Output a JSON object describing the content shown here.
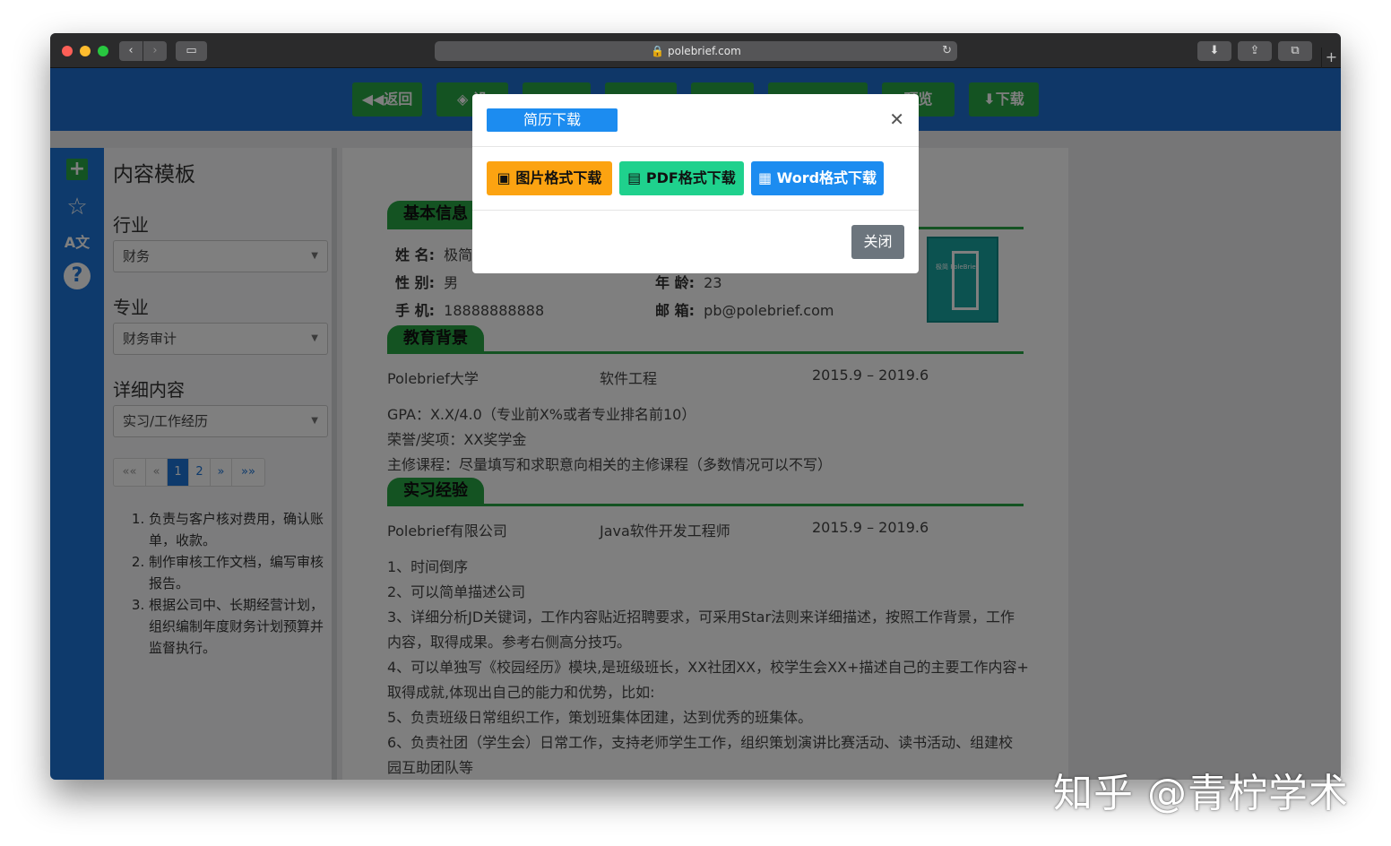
{
  "browser": {
    "url": "polebrief.com",
    "lock_icon": "lock-icon",
    "back_icon": "chevron-left-icon",
    "forward_icon": "chevron-right-icon"
  },
  "toolbar": {
    "back_label": "返回",
    "btn2_label": "设",
    "preview_label": "预览",
    "download_label": "下载"
  },
  "sidebar": {
    "title": "内容模板",
    "industry_label": "行业",
    "industry_value": "财务",
    "major_label": "专业",
    "major_value": "财务审计",
    "detail_label": "详细内容",
    "detail_value": "实习/工作经历",
    "pager": {
      "first": "««",
      "prev": "«",
      "p1": "1",
      "p2": "2",
      "next": "»",
      "last": "»»"
    },
    "items": [
      "负责与客户核对费用，确认账单，收款。",
      "制作审核工作文档，编写审核报告。",
      "根据公司中、长期经营计划，组织编制年度财务计划预算并监督执行。"
    ]
  },
  "resume": {
    "basic_title": "基本信息",
    "name_label": "姓 名:",
    "name_value": "极简",
    "gender_label": "性 别:",
    "gender_value": "男",
    "age_label": "年 龄:",
    "age_value": "23",
    "phone_label": "手 机:",
    "phone_value": "18888888888",
    "email_label": "邮 箱:",
    "email_value": "pb@polebrief.com",
    "photo_text": "极简\nPoleBrief",
    "edu_title": "教育背景",
    "edu_school": "Polebrief大学",
    "edu_major": "软件工程",
    "edu_period": "2015.9 – 2019.6",
    "edu_gpa": "GPA：X.X/4.0（专业前X%或者专业排名前10）",
    "edu_honor": "荣誉/奖项：XX奖学金",
    "edu_course": "主修课程：尽量填写和求职意向相关的主修课程（多数情况可以不写）",
    "intern_title": "实习经验",
    "intern_company": "Polebrief有限公司",
    "intern_role": "Java软件开发工程师",
    "intern_period": "2015.9 – 2019.6",
    "intern_lines": [
      "1、时间倒序",
      "2、可以简单描述公司",
      "3、详细分析JD关键词，工作内容贴近招聘要求，可采用Star法则来详细描述，按照工作背景，工作",
      "内容，取得成果。参考右侧高分技巧。",
      "4、可以单独写《校园经历》模块,是班级班长，XX社团XX，校学生会XX+描述自己的主要工作内容+",
      "取得成就,体现出自己的能力和优势，比如:",
      "5、负责班级日常组织工作，策划班集体团建，达到优秀的班集体。",
      "6、负责社团（学生会）日常工作，支持老师学生工作，组织策划演讲比赛活动、读书活动、组建校",
      "园互助团队等"
    ]
  },
  "modal": {
    "title": "简历下载",
    "img_label": "图片格式下载",
    "pdf_label": "PDF格式下载",
    "word_label": "Word格式下载",
    "close_label": "关闭"
  },
  "watermark": "知乎 @青柠学术",
  "colors": {
    "brand_blue": "#1f6fd0",
    "green": "#28a745",
    "orange": "#fca311",
    "teal": "#1fd18d",
    "modal_blue": "#1c8cf0"
  }
}
